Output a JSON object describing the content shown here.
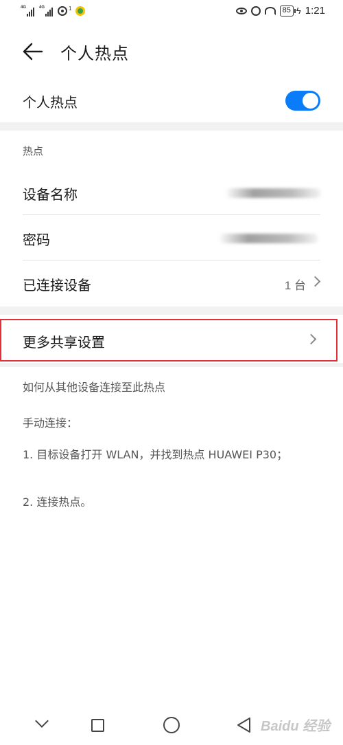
{
  "status_bar": {
    "signal1_tag": "4G",
    "signal2_tag": "4G",
    "hotspot_superscript": "1",
    "battery": "85",
    "time": "1:21",
    "icons": [
      "signal-icon",
      "signal-icon",
      "hotspot-icon",
      "app-notification-icon",
      "eye-icon",
      "alarm-icon",
      "speed-gauge-icon",
      "battery-icon",
      "charging-icon"
    ]
  },
  "header": {
    "title": "个人热点",
    "back_icon": "arrow-left-icon"
  },
  "toggle": {
    "label": "个人热点",
    "on": true,
    "color": "#0a7cf8"
  },
  "hotspot_section": {
    "label": "热点",
    "rows": [
      {
        "label": "设备名称",
        "value": ""
      },
      {
        "label": "密码",
        "value": ""
      },
      {
        "label": "已连接设备",
        "value": "1 台"
      }
    ]
  },
  "more_settings": {
    "label": "更多共享设置",
    "highlight_color": "#e0303a"
  },
  "instructions": {
    "heading": "如何从其他设备连接至此热点",
    "manual": "手动连接：",
    "step1": "1. 目标设备打开 WLAN，并找到热点 HUAWEI P30；",
    "step2": "2. 连接热点。"
  },
  "nav_bar": {
    "icons": [
      "chevron-down-icon",
      "recent-apps-icon",
      "home-icon",
      "back-icon"
    ]
  },
  "watermark": "Baidu 经验"
}
